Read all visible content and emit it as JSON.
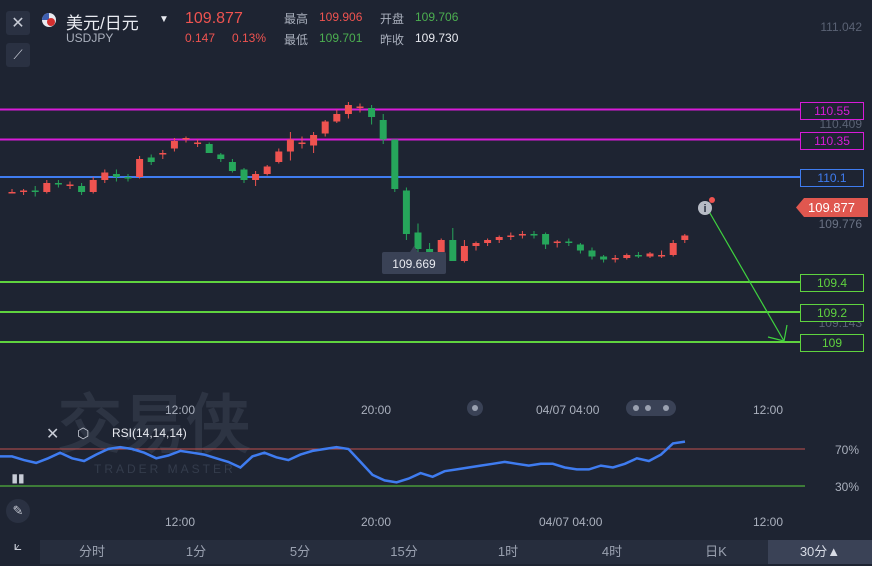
{
  "header": {
    "title": "美元/日元",
    "symbol": "USDJPY",
    "price": "109.877",
    "change": "0.147",
    "change_pct": "0.13%",
    "high_label": "最高",
    "high": "109.906",
    "low_label": "最低",
    "low": "109.701",
    "open_label": "开盘",
    "open": "109.706",
    "prev_close_label": "昨收",
    "prev_close": "109.730"
  },
  "price_axis": {
    "ticks": [
      "111.042",
      "110.409",
      "109.776",
      "109.143"
    ],
    "current_price_tag": "109.877",
    "low_marker": "109.669"
  },
  "levels": [
    {
      "value": 110.55,
      "label": "110.55",
      "color": "#d81bd8"
    },
    {
      "value": 110.35,
      "label": "110.35",
      "color": "#d81bd8"
    },
    {
      "value": 110.1,
      "label": "110.1",
      "color": "#3f7cf0"
    },
    {
      "value": 109.4,
      "label": "109.4",
      "color": "#5fd33f"
    },
    {
      "value": 109.2,
      "label": "109.2",
      "color": "#5fd33f"
    },
    {
      "value": 109.0,
      "label": "109",
      "color": "#5fd33f"
    }
  ],
  "time_axis": [
    "12:00",
    "20:00",
    "04/07 04:00",
    "12:00"
  ],
  "watermark": {
    "main": "交易侠",
    "sub": "TRADER MASTER"
  },
  "indicator": {
    "name": "RSI(14,14,14)",
    "levels": [
      "70%",
      "30%"
    ],
    "series": [
      62,
      62,
      58,
      55,
      60,
      66,
      60,
      57,
      64,
      70,
      72,
      70,
      66,
      60,
      63,
      68,
      66,
      64,
      60,
      56,
      50,
      62,
      66,
      61,
      58,
      64,
      68,
      70,
      72,
      70,
      56,
      42,
      36,
      34,
      38,
      44,
      40,
      46,
      48,
      50,
      52,
      54,
      56,
      54,
      52,
      54,
      54,
      50,
      48,
      48,
      52,
      50,
      54,
      60,
      57,
      64,
      76,
      78
    ]
  },
  "tabs": [
    {
      "label": "分时",
      "active": false
    },
    {
      "label": "1分",
      "active": false
    },
    {
      "label": "5分",
      "active": false
    },
    {
      "label": "15分",
      "active": false
    },
    {
      "label": "1时",
      "active": false
    },
    {
      "label": "4时",
      "active": false
    },
    {
      "label": "日K",
      "active": false
    },
    {
      "label": "30分▲",
      "active": true
    }
  ],
  "colors": {
    "up": "#ef5350",
    "down": "#26a65b",
    "rsi_line": "#3f7cf0",
    "rsi_upper": "#c0504d",
    "rsi_lower": "#5fd33f",
    "forecast_arrow": "#3fd33f"
  },
  "chart_data": {
    "type": "candlestick",
    "y_range": [
      108.9,
      111.1
    ],
    "candles": [
      {
        "o": 110.0,
        "h": 110.02,
        "l": 109.99,
        "c": 110.0
      },
      {
        "o": 110.0,
        "h": 110.02,
        "l": 109.98,
        "c": 110.01
      },
      {
        "o": 110.01,
        "h": 110.04,
        "l": 109.97,
        "c": 110.0
      },
      {
        "o": 110.0,
        "h": 110.08,
        "l": 109.99,
        "c": 110.06
      },
      {
        "o": 110.06,
        "h": 110.08,
        "l": 110.03,
        "c": 110.05
      },
      {
        "o": 110.05,
        "h": 110.07,
        "l": 110.02,
        "c": 110.05
      },
      {
        "o": 110.04,
        "h": 110.06,
        "l": 109.98,
        "c": 110.0
      },
      {
        "o": 110.0,
        "h": 110.1,
        "l": 109.99,
        "c": 110.08
      },
      {
        "o": 110.08,
        "h": 110.15,
        "l": 110.06,
        "c": 110.13
      },
      {
        "o": 110.12,
        "h": 110.15,
        "l": 110.07,
        "c": 110.1
      },
      {
        "o": 110.1,
        "h": 110.12,
        "l": 110.07,
        "c": 110.09
      },
      {
        "o": 110.1,
        "h": 110.24,
        "l": 110.09,
        "c": 110.22
      },
      {
        "o": 110.23,
        "h": 110.25,
        "l": 110.18,
        "c": 110.2
      },
      {
        "o": 110.25,
        "h": 110.28,
        "l": 110.22,
        "c": 110.26
      },
      {
        "o": 110.29,
        "h": 110.36,
        "l": 110.27,
        "c": 110.34
      },
      {
        "o": 110.36,
        "h": 110.37,
        "l": 110.33,
        "c": 110.36
      },
      {
        "o": 110.33,
        "h": 110.35,
        "l": 110.3,
        "c": 110.33
      },
      {
        "o": 110.32,
        "h": 110.33,
        "l": 110.26,
        "c": 110.26
      },
      {
        "o": 110.25,
        "h": 110.26,
        "l": 110.2,
        "c": 110.22
      },
      {
        "o": 110.2,
        "h": 110.22,
        "l": 110.13,
        "c": 110.14
      },
      {
        "o": 110.15,
        "h": 110.16,
        "l": 110.06,
        "c": 110.08
      },
      {
        "o": 110.08,
        "h": 110.14,
        "l": 110.04,
        "c": 110.12
      },
      {
        "o": 110.12,
        "h": 110.18,
        "l": 110.11,
        "c": 110.17
      },
      {
        "o": 110.2,
        "h": 110.29,
        "l": 110.19,
        "c": 110.27
      },
      {
        "o": 110.27,
        "h": 110.4,
        "l": 110.21,
        "c": 110.35
      },
      {
        "o": 110.33,
        "h": 110.37,
        "l": 110.29,
        "c": 110.33
      },
      {
        "o": 110.31,
        "h": 110.4,
        "l": 110.26,
        "c": 110.38
      },
      {
        "o": 110.39,
        "h": 110.48,
        "l": 110.37,
        "c": 110.47
      },
      {
        "o": 110.47,
        "h": 110.55,
        "l": 110.46,
        "c": 110.52
      },
      {
        "o": 110.52,
        "h": 110.6,
        "l": 110.49,
        "c": 110.58
      },
      {
        "o": 110.57,
        "h": 110.59,
        "l": 110.53,
        "c": 110.57
      },
      {
        "o": 110.56,
        "h": 110.58,
        "l": 110.45,
        "c": 110.5
      },
      {
        "o": 110.48,
        "h": 110.52,
        "l": 110.32,
        "c": 110.35
      },
      {
        "o": 110.35,
        "h": 110.35,
        "l": 110.0,
        "c": 110.02
      },
      {
        "o": 110.01,
        "h": 110.03,
        "l": 109.68,
        "c": 109.72
      },
      {
        "o": 109.73,
        "h": 109.79,
        "l": 109.6,
        "c": 109.62
      },
      {
        "o": 109.62,
        "h": 109.66,
        "l": 109.5,
        "c": 109.59
      },
      {
        "o": 109.6,
        "h": 109.69,
        "l": 109.59,
        "c": 109.68
      },
      {
        "o": 109.68,
        "h": 109.76,
        "l": 109.56,
        "c": 109.54
      },
      {
        "o": 109.54,
        "h": 109.68,
        "l": 109.53,
        "c": 109.64
      },
      {
        "o": 109.64,
        "h": 109.67,
        "l": 109.61,
        "c": 109.66
      },
      {
        "o": 109.66,
        "h": 109.69,
        "l": 109.64,
        "c": 109.68
      },
      {
        "o": 109.68,
        "h": 109.71,
        "l": 109.66,
        "c": 109.7
      },
      {
        "o": 109.7,
        "h": 109.73,
        "l": 109.68,
        "c": 109.71
      },
      {
        "o": 109.72,
        "h": 109.74,
        "l": 109.69,
        "c": 109.72
      },
      {
        "o": 109.72,
        "h": 109.74,
        "l": 109.69,
        "c": 109.71
      },
      {
        "o": 109.72,
        "h": 109.73,
        "l": 109.62,
        "c": 109.65
      },
      {
        "o": 109.66,
        "h": 109.68,
        "l": 109.63,
        "c": 109.67
      },
      {
        "o": 109.67,
        "h": 109.69,
        "l": 109.64,
        "c": 109.66
      },
      {
        "o": 109.65,
        "h": 109.66,
        "l": 109.59,
        "c": 109.61
      },
      {
        "o": 109.61,
        "h": 109.63,
        "l": 109.55,
        "c": 109.57
      },
      {
        "o": 109.57,
        "h": 109.58,
        "l": 109.53,
        "c": 109.55
      },
      {
        "o": 109.55,
        "h": 109.58,
        "l": 109.53,
        "c": 109.56
      },
      {
        "o": 109.56,
        "h": 109.59,
        "l": 109.55,
        "c": 109.58
      },
      {
        "o": 109.58,
        "h": 109.6,
        "l": 109.56,
        "c": 109.57
      },
      {
        "o": 109.57,
        "h": 109.6,
        "l": 109.56,
        "c": 109.59
      },
      {
        "o": 109.58,
        "h": 109.61,
        "l": 109.56,
        "c": 109.58
      },
      {
        "o": 109.58,
        "h": 109.68,
        "l": 109.57,
        "c": 109.66
      },
      {
        "o": 109.68,
        "h": 109.72,
        "l": 109.66,
        "c": 109.71
      }
    ]
  }
}
